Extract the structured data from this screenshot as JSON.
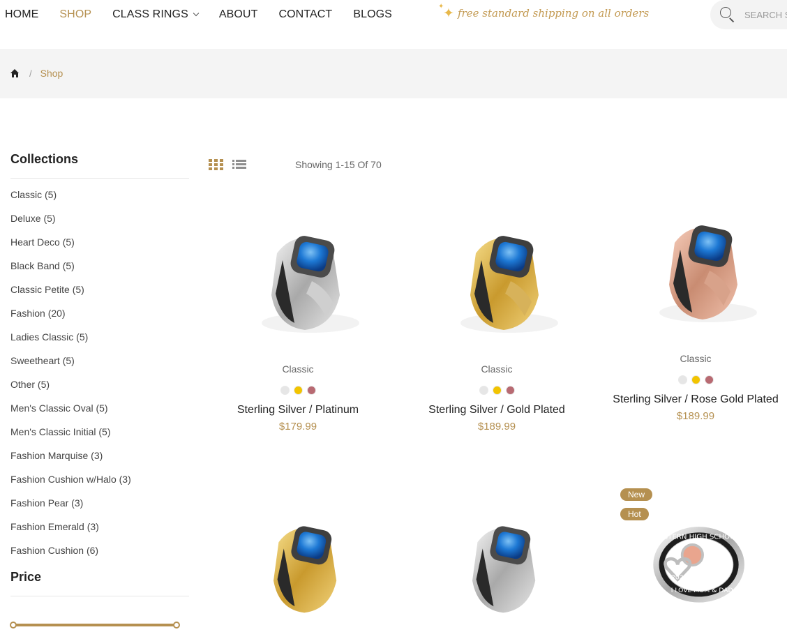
{
  "nav": {
    "items": [
      {
        "label": "HOME",
        "active": false
      },
      {
        "label": "SHOP",
        "active": true
      },
      {
        "label": "CLASS RINGS",
        "active": false
      },
      {
        "label": "ABOUT",
        "active": false
      },
      {
        "label": "CONTACT",
        "active": false
      },
      {
        "label": "BLOGS",
        "active": false
      }
    ]
  },
  "promo": {
    "text": "free standard shipping on all orders"
  },
  "search": {
    "placeholder": "SEARCH S"
  },
  "breadcrumb": {
    "separator": "/",
    "current": "Shop"
  },
  "sidebar": {
    "collections_title": "Collections",
    "collections": [
      "Classic (5)",
      "Deluxe (5)",
      "Heart Deco (5)",
      "Black Band (5)",
      "Classic Petite (5)",
      "Fashion (20)",
      "Ladies Classic (5)",
      "Sweetheart (5)",
      "Other (5)",
      "Men's Classic Oval (5)",
      "Men's Classic Initial (5)",
      "Fashion Marquise (3)",
      "Fashion Cushion w/Halo (3)",
      "Fashion Pear (3)",
      "Fashion Emerald (3)",
      "Fashion Cushion (6)"
    ],
    "price_title": "Price"
  },
  "toolbar": {
    "showing": "Showing 1-15 Of 70"
  },
  "colors": {
    "accent": "#b59050",
    "swatch_silver": "#e6e6e6",
    "swatch_gold": "#f2c400",
    "swatch_rose": "#b86a72"
  },
  "products": [
    {
      "category": "Classic",
      "name": "Sterling Silver / Platinum",
      "price": "$179.99",
      "metal": "silver"
    },
    {
      "category": "Classic",
      "name": "Sterling Silver / Gold Plated",
      "price": "$189.99",
      "metal": "gold"
    },
    {
      "category": "Classic",
      "name": "Sterling Silver / Rose Gold Plated",
      "price": "$189.99",
      "metal": "rose"
    },
    {
      "metal": "gold"
    },
    {
      "metal": "silver"
    },
    {
      "badges": [
        "New",
        "Hot"
      ],
      "metal": "silver-heart",
      "engraving": [
        "WESTERN HIGH SCHOOL",
        "2023",
        "I LOVE MOM & DAD"
      ]
    }
  ]
}
